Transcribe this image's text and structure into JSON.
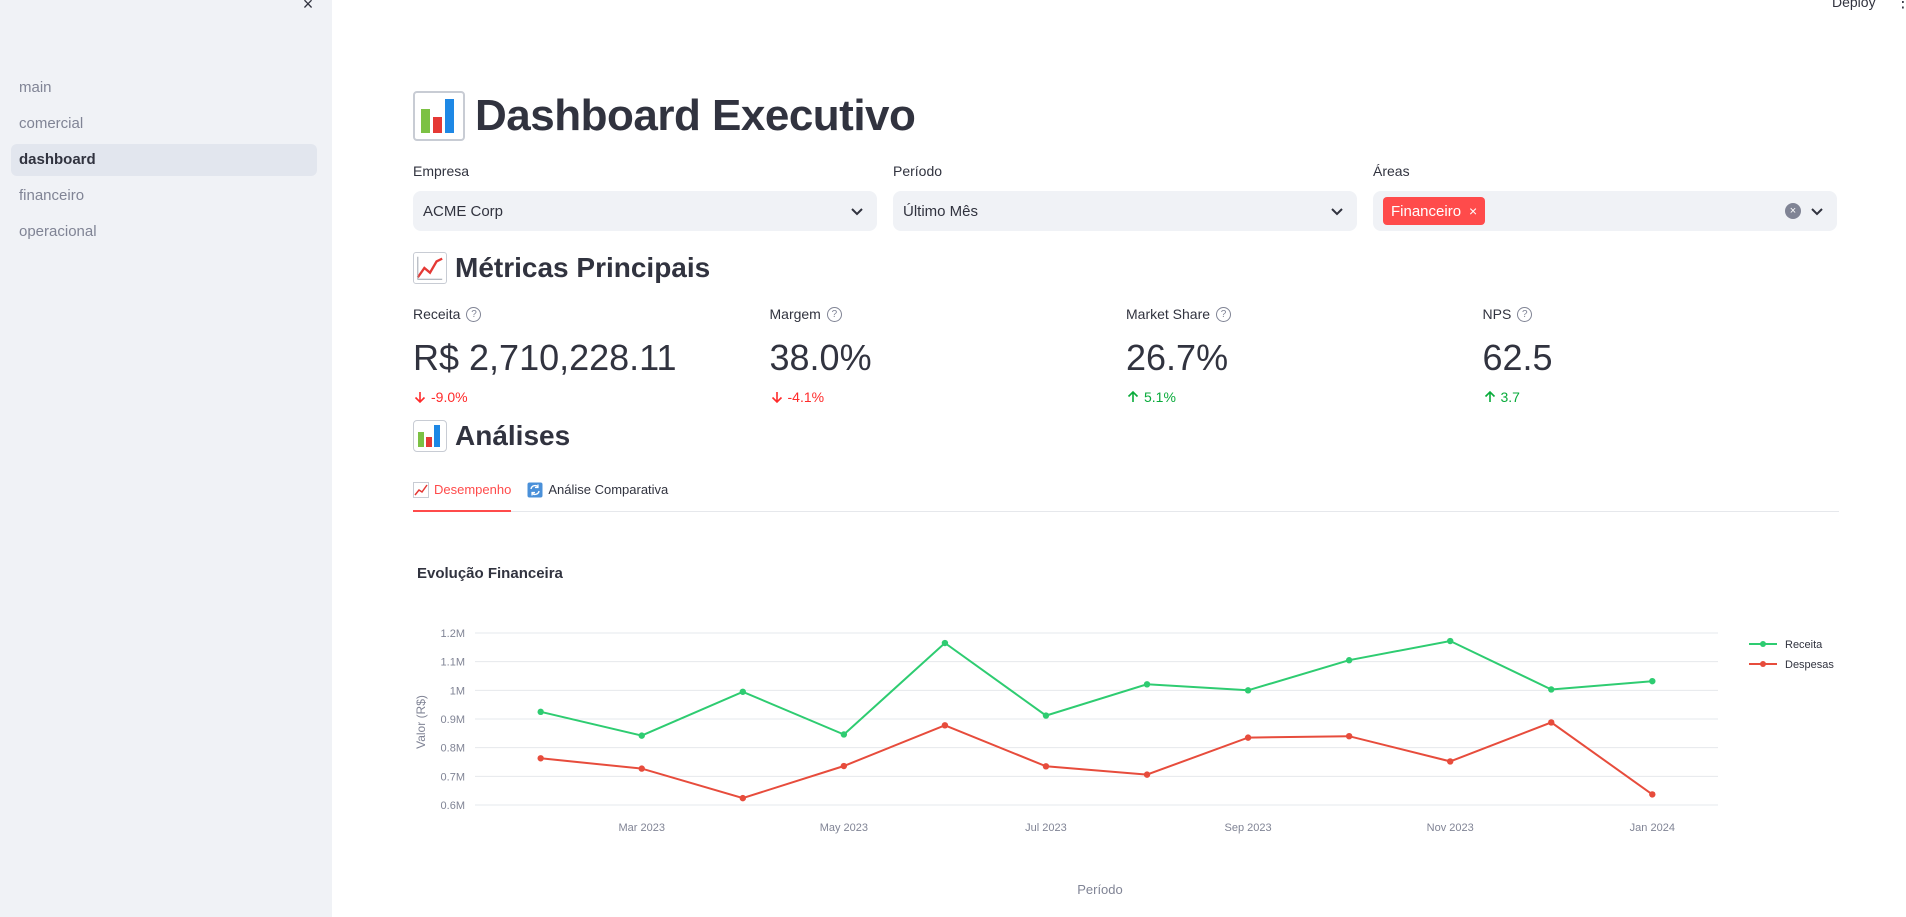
{
  "sidebar": {
    "close_glyph": "×",
    "items": [
      {
        "label": "main",
        "active": false
      },
      {
        "label": "comercial",
        "active": false
      },
      {
        "label": "dashboard",
        "active": true
      },
      {
        "label": "financeiro",
        "active": false
      },
      {
        "label": "operacional",
        "active": false
      }
    ]
  },
  "header": {
    "deploy_label": "Deploy",
    "menu_glyph": "⋮"
  },
  "page": {
    "title": "Dashboard Executivo",
    "title_icon": "bar-chart-icon"
  },
  "filters": {
    "empresa": {
      "label": "Empresa",
      "value": "ACME Corp"
    },
    "periodo": {
      "label": "Período",
      "value": "Último Mês"
    },
    "areas": {
      "label": "Áreas",
      "tags": [
        "Financeiro"
      ],
      "tag_color": "#ff4b4b"
    }
  },
  "metrics_section": {
    "title": "Métricas Principais",
    "icon": "chart-increasing-icon"
  },
  "metrics": [
    {
      "label": "Receita",
      "value": "R$ 2,710,228.11",
      "delta": "-9.0%",
      "direction": "down"
    },
    {
      "label": "Margem",
      "value": "38.0%",
      "delta": "-4.1%",
      "direction": "down"
    },
    {
      "label": "Market Share",
      "value": "26.7%",
      "delta": "5.1%",
      "direction": "up"
    },
    {
      "label": "NPS",
      "value": "62.5",
      "delta": "3.7",
      "direction": "up"
    }
  ],
  "analyses_section": {
    "title": "Análises",
    "icon": "bar-chart-icon"
  },
  "tabs": [
    {
      "label": "Desempenho",
      "icon": "chart-increasing-icon",
      "active": true
    },
    {
      "label": "Análise Comparativa",
      "icon": "refresh-arrows-icon",
      "active": false
    }
  ],
  "chart_data": {
    "type": "line",
    "title": "Evolução Financeira",
    "xlabel": "Período",
    "ylabel": "Valor (R$)",
    "x": [
      "2023-02",
      "2023-03",
      "2023-04",
      "2023-05",
      "2023-06",
      "2023-07",
      "2023-08",
      "2023-09",
      "2023-10",
      "2023-11",
      "2023-12",
      "2024-01"
    ],
    "x_ticks": [
      "Mar 2023",
      "May 2023",
      "Jul 2023",
      "Sep 2023",
      "Nov 2023",
      "Jan 2024"
    ],
    "y_ticks": [
      "0.6M",
      "0.7M",
      "0.8M",
      "0.9M",
      "1M",
      "1.1M",
      "1.2M"
    ],
    "ylim": [
      600000,
      1200000
    ],
    "grid": true,
    "legend_position": "top-right",
    "series": [
      {
        "name": "Receita",
        "color": "#2ecc71",
        "values": [
          925000,
          842000,
          995000,
          846000,
          1165000,
          912000,
          1021000,
          1000000,
          1105000,
          1172000,
          1003000,
          1032000
        ]
      },
      {
        "name": "Despesas",
        "color": "#e74c3c",
        "values": [
          763000,
          727000,
          624000,
          736000,
          878000,
          735000,
          706000,
          835000,
          840000,
          752000,
          888000,
          637000
        ]
      }
    ]
  }
}
